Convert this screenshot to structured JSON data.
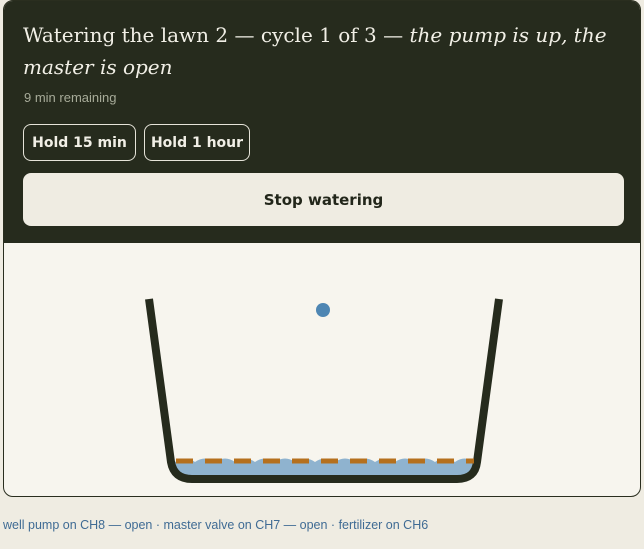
{
  "status": {
    "title_main": "Watering the lawn 2 — cycle 1 of 3 — ",
    "title_state": "the pump is up, the master is open",
    "remaining": "9 min remaining"
  },
  "actions": {
    "hold_15": "Hold 15 min",
    "hold_60": "Hold 1 hour",
    "stop": "Stop watering"
  },
  "footer": {
    "channels": "well pump on CH8 — open · master valve on CH7 — open · fertilizer on CH6"
  },
  "colors": {
    "header_bg": "#262b1d",
    "pipe": "#262b1d",
    "water": "#8fb3cf",
    "drip_line": "#b5701d",
    "droplet": "#4e86b3",
    "link_text": "#3f6b94"
  },
  "icons": {
    "droplet": "water-droplet-icon",
    "tray": "planter-tray-icon"
  }
}
